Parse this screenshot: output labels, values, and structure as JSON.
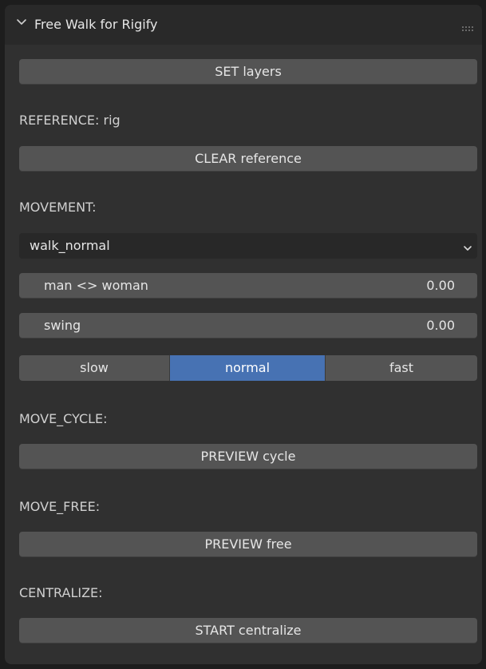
{
  "panel": {
    "title": "Free Walk for Rigify",
    "icons": {
      "collapse": "chevron-down-icon",
      "drag": "drag-grip-icon"
    }
  },
  "set_layers_button": "SET layers",
  "reference_label": "REFERENCE: rig",
  "clear_reference_button": "CLEAR reference",
  "movement": {
    "label": "MOVEMENT:",
    "selected": "walk_normal",
    "sliders": [
      {
        "label": "man <> woman",
        "value": "0.00"
      },
      {
        "label": "swing",
        "value": "0.00"
      }
    ],
    "speed_options": [
      "slow",
      "normal",
      "fast"
    ],
    "speed_selected": "normal"
  },
  "move_cycle": {
    "label": "MOVE_CYCLE:",
    "button": "PREVIEW cycle"
  },
  "move_free": {
    "label": "MOVE_FREE:",
    "button": "PREVIEW free"
  },
  "centralize": {
    "label": "CENTRALIZE:",
    "button": "START centralize"
  },
  "colors": {
    "panel_bg": "#303030",
    "header_bg": "#292929",
    "button_bg": "#545454",
    "dropdown_bg": "#282828",
    "accent": "#4772b3",
    "text": "#e6e6e6"
  }
}
